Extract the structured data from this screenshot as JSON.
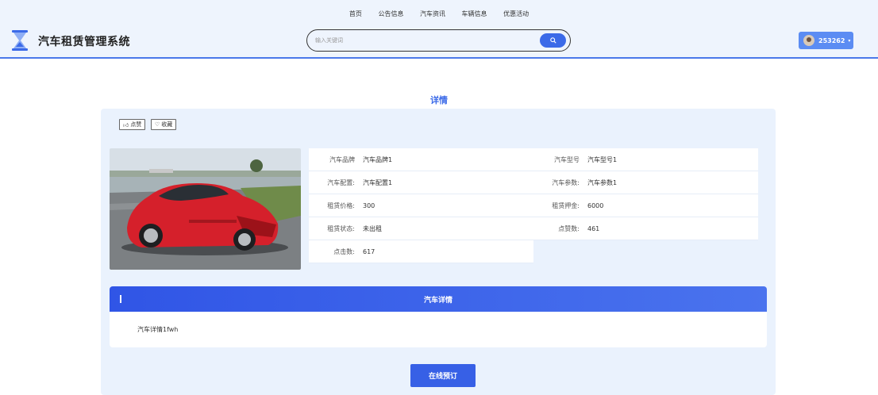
{
  "nav": {
    "items": [
      "首页",
      "公告信息",
      "汽车资讯",
      "车辆信息",
      "优惠活动"
    ]
  },
  "header": {
    "app_title": "汽车租赁管理系统"
  },
  "search": {
    "placeholder": "输入关键词"
  },
  "user": {
    "name": "253262"
  },
  "page": {
    "title": "详情"
  },
  "actions": {
    "like_label": "点赞",
    "favorite_label": "收藏"
  },
  "info": {
    "left": [
      {
        "key": "汽车品牌",
        "value": "汽车品牌1"
      },
      {
        "key": "汽车配置:",
        "value": "汽车配置1"
      },
      {
        "key": "租赁价格:",
        "value": "300"
      },
      {
        "key": "租赁状态:",
        "value": "未出租"
      },
      {
        "key": "点击数:",
        "value": "617"
      }
    ],
    "right": [
      {
        "key": "汽车型号",
        "value": "汽车型号1"
      },
      {
        "key": "汽车参数:",
        "value": "汽车参数1"
      },
      {
        "key": "租赁押金:",
        "value": "6000"
      },
      {
        "key": "点赞数:",
        "value": "461"
      }
    ]
  },
  "detail": {
    "header": "汽车详情",
    "content": "汽车详情1fwh"
  },
  "book_button": {
    "label": "在线预订"
  },
  "colors": {
    "accent": "#3b6ae8",
    "header_bg": "#eef4fd",
    "panel_bg": "#eaf2fd",
    "car_red": "#d5202b"
  }
}
